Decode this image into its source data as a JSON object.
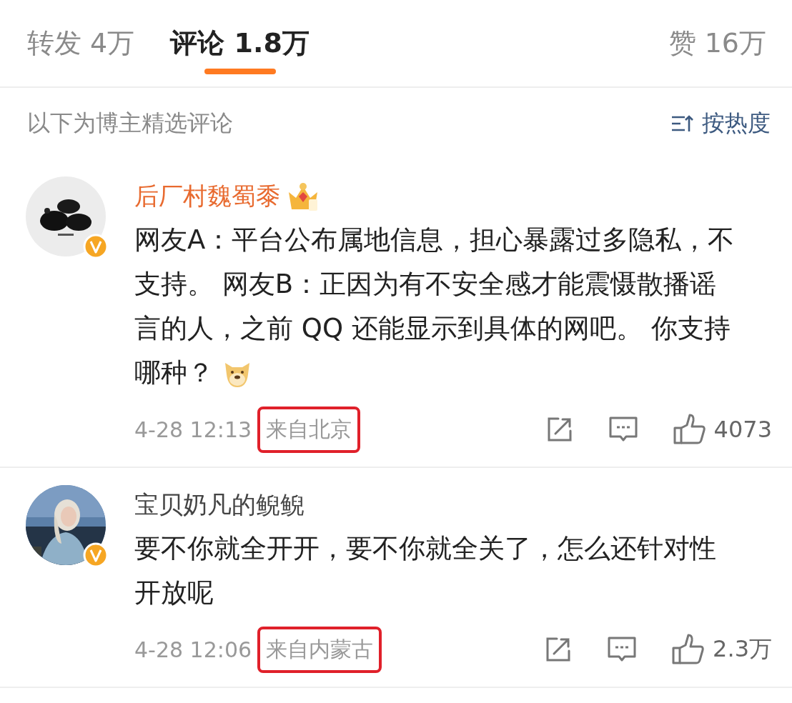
{
  "tabs": [
    {
      "label": "转发",
      "count": "4万",
      "selected": false
    },
    {
      "label": "评论",
      "count": "1.8万",
      "selected": true
    }
  ],
  "likes": {
    "label": "赞",
    "count": "16万"
  },
  "section": {
    "title": "以下为博主精选评论",
    "sort": "按热度"
  },
  "comments": [
    {
      "author": "后厂村魏蜀黍",
      "vip": true,
      "verified": true,
      "text": "网友A：平台公布属地信息，担心暴露过多隐私，不支持。 网友B：正因为有不安全感才能震慑散播谣言的人，之前 QQ 还能显示到具体的网吧。 你支持哪种？",
      "trailing_emoji": true,
      "time": "4-28 12:13",
      "location": "来自北京",
      "highlighted": true,
      "like_count": "4073"
    },
    {
      "author": "宝贝奶凡的鲵鲵",
      "vip": false,
      "verified": true,
      "text": "要不你就全开开，要不你就全关了，怎么还针对性开放呢",
      "trailing_emoji": false,
      "time": "4-28 12:06",
      "location": "来自内蒙古",
      "highlighted": true,
      "like_count": "2.3万"
    }
  ]
}
